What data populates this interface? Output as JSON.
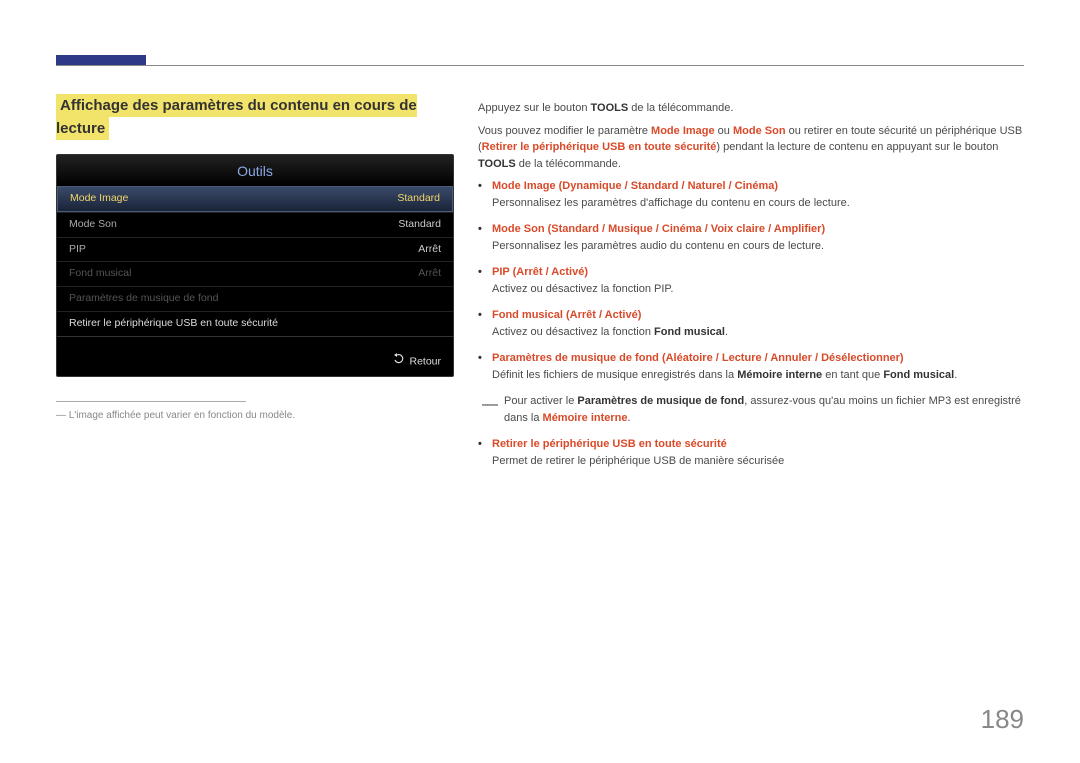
{
  "section_title": "Affichage des paramètres du contenu en cours de lecture",
  "outils": {
    "title": "Outils",
    "rows": [
      {
        "label": "Mode Image",
        "value": "Standard",
        "selected": true
      },
      {
        "label": "Mode Son",
        "value": "Standard"
      },
      {
        "label": "PIP",
        "value": "Arrêt"
      },
      {
        "label": "Fond musical",
        "value": "Arrêt",
        "dim": true
      },
      {
        "label": "Paramètres de musique de fond",
        "value": "",
        "dim": true
      },
      {
        "label": "Retirer le périphérique USB en toute sécurité",
        "value": ""
      }
    ],
    "footer": "Retour"
  },
  "footnote_prefix": "―",
  "footnote": "L'image affichée peut varier en fonction du modèle.",
  "right": {
    "p1_a": "Appuyez sur le bouton ",
    "p1_b": "TOOLS",
    "p1_c": " de la télécommande.",
    "p2_a": "Vous pouvez modifier le paramètre ",
    "p2_b": "Mode Image",
    "p2_c": " ou ",
    "p2_d": "Mode Son",
    "p2_e": " ou retirer en toute sécurité un périphérique USB (",
    "p2_f": "Retirer le périphérique USB en toute sécurité",
    "p2_g": ") pendant la lecture de contenu en appuyant sur le bouton ",
    "p2_h": "TOOLS",
    "p2_i": " de la télécommande.",
    "b1_label": "Mode Image",
    "b1_opts": " (Dynamique / Standard / Naturel / Cinéma)",
    "b1_desc": "Personnalisez les paramètres d'affichage du contenu en cours de lecture.",
    "b2_label": "Mode Son",
    "b2_opts": " (Standard / Musique / Cinéma / Voix claire / Amplifier)",
    "b2_desc": "Personnalisez les paramètres audio du contenu en cours de lecture.",
    "b3_label": "PIP",
    "b3_opts": " (Arrêt / Activé)",
    "b3_desc": "Activez ou désactivez la fonction PIP.",
    "b4_label": "Fond musical",
    "b4_opts": " (Arrêt / Activé)",
    "b4_desc_a": "Activez ou désactivez la fonction ",
    "b4_desc_b": "Fond musical",
    "b4_desc_c": ".",
    "b5_label": "Paramètres de musique de fond",
    "b5_opts": " (Aléatoire / Lecture / Annuler / Désélectionner)",
    "b5_desc_a": "Définit les fichiers de musique enregistrés dans la ",
    "b5_desc_b": "Mémoire interne",
    "b5_desc_c": " en tant que ",
    "b5_desc_d": "Fond musical",
    "b5_desc_e": ".",
    "note_a": "Pour activer le ",
    "note_b": "Paramètres de musique de fond",
    "note_c": ", assurez-vous qu'au moins un fichier MP3 est enregistré dans la ",
    "note_d": "Mémoire interne",
    "note_e": ".",
    "b6_label": "Retirer le périphérique USB en toute sécurité",
    "b6_desc": "Permet de retirer le périphérique USB de manière sécurisée"
  },
  "page_number": "189"
}
